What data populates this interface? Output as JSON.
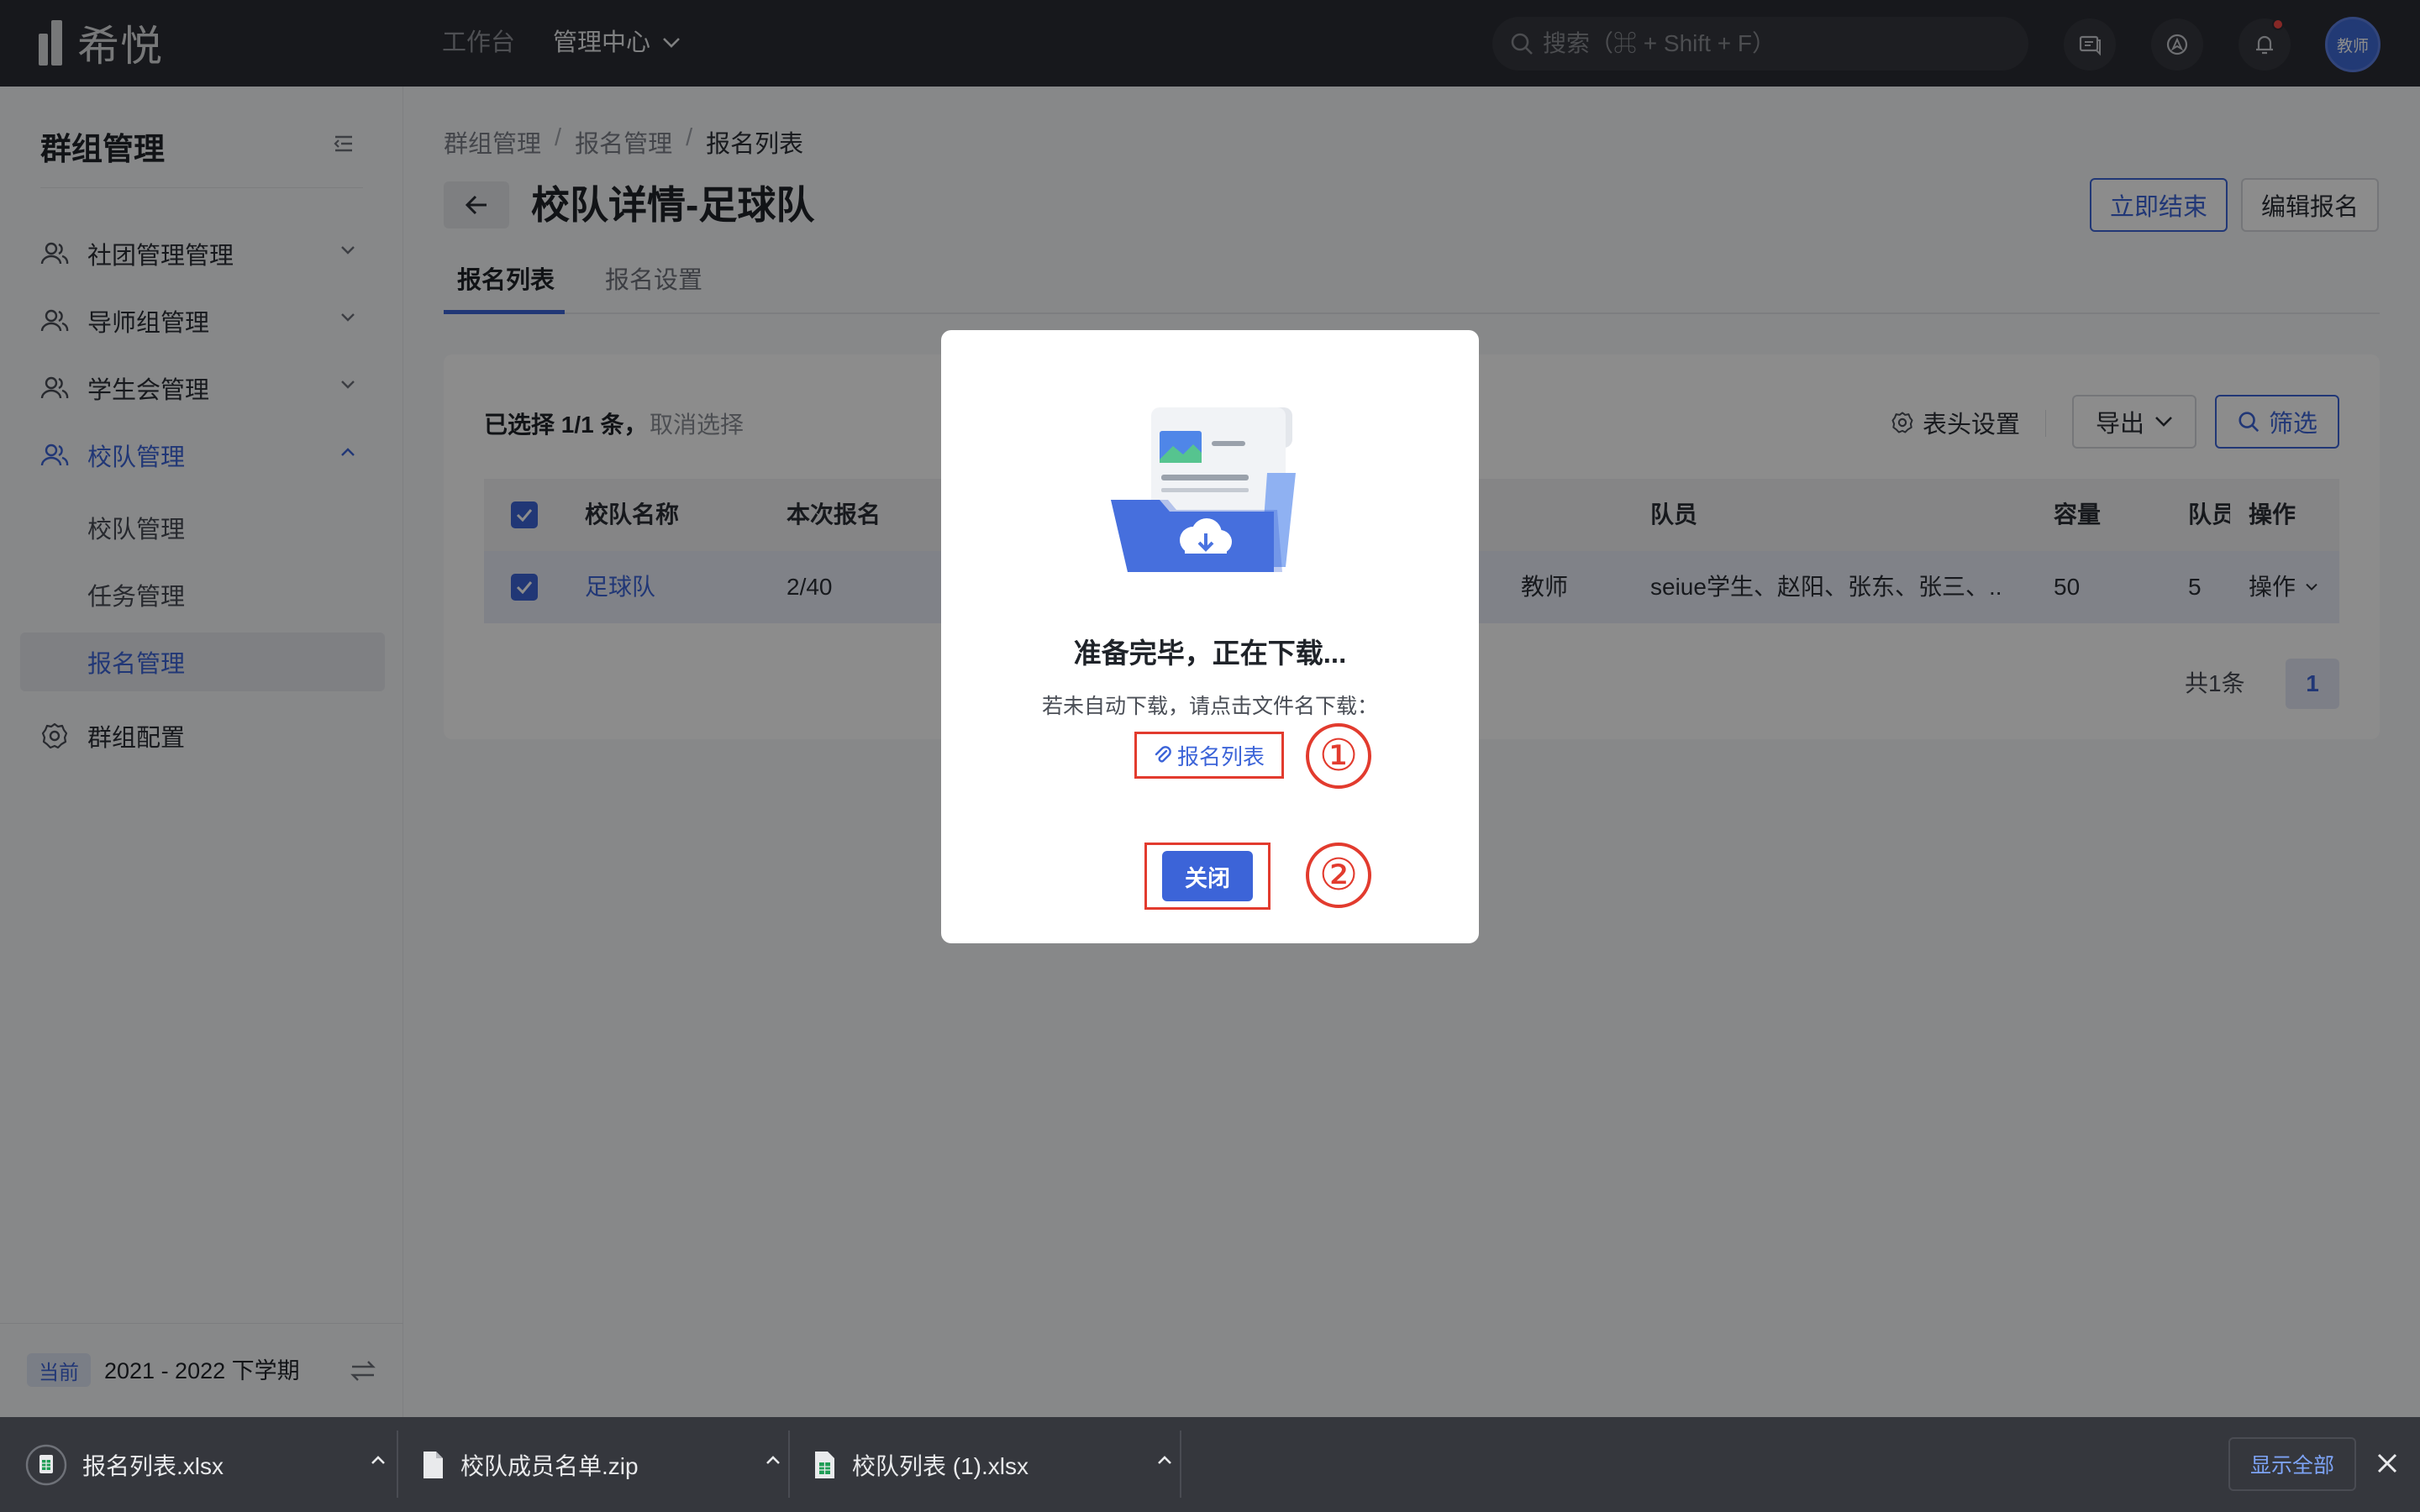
{
  "topbar": {
    "logo_text": "希悦",
    "nav_workbench": "工作台",
    "nav_admin": "管理中心",
    "search_placeholder": "搜索（⌘ + Shift + F）",
    "avatar_label": "教师"
  },
  "sidebar": {
    "title": "群组管理",
    "menu": [
      {
        "label": "社团管理管理",
        "icon": "users-icon"
      },
      {
        "label": "导师组管理",
        "icon": "users-icon"
      },
      {
        "label": "学生会管理",
        "icon": "users-icon"
      },
      {
        "label": "校队管理",
        "icon": "users-icon",
        "expanded": true
      }
    ],
    "submenu": [
      {
        "label": "校队管理"
      },
      {
        "label": "任务管理"
      },
      {
        "label": "报名管理",
        "selected": true
      }
    ],
    "config_label": "群组配置",
    "term_badge": "当前",
    "term_text": "2021 - 2022 下学期"
  },
  "page": {
    "breadcrumb": [
      "群组管理",
      "报名管理",
      "报名列表"
    ],
    "title": "校队详情-足球队",
    "btn_end": "立即结束",
    "btn_edit": "编辑报名",
    "tabs": [
      "报名列表",
      "报名设置"
    ]
  },
  "table": {
    "selection_text": "已选择 1/1 条，",
    "cancel_selection": "取消选择",
    "column_settings": "表头设置",
    "export": "导出",
    "filter": "筛选",
    "headers": [
      "校队名称",
      "本次报名",
      "队员",
      "容量",
      "队员",
      "操作"
    ],
    "row": {
      "name": "足球队",
      "enrolled": "2/40",
      "teacher_fragment": "教师",
      "members": "seiue学生、赵阳、张东、张三、...",
      "capacity": "50",
      "member_count": "5",
      "action": "操作"
    },
    "total": "共1条",
    "page": "1"
  },
  "dialog": {
    "title": "准备完毕，正在下载...",
    "hint": "若未自动下载，请点击文件名下载：",
    "file_link": "报名列表",
    "close": "关闭",
    "step1": "①",
    "step2": "②"
  },
  "downloads": {
    "items": [
      {
        "name": "报名列表.xlsx",
        "icon": "spreadsheet-icon"
      },
      {
        "name": "校队成员名单.zip",
        "icon": "file-icon"
      },
      {
        "name": "校队列表 (1).xlsx",
        "icon": "spreadsheet-icon"
      }
    ],
    "show_all": "显示全部"
  },
  "colors": {
    "accent": "#3c64d8",
    "annotation_red": "#e23b2e",
    "topbar_bg": "#2b2d33"
  }
}
